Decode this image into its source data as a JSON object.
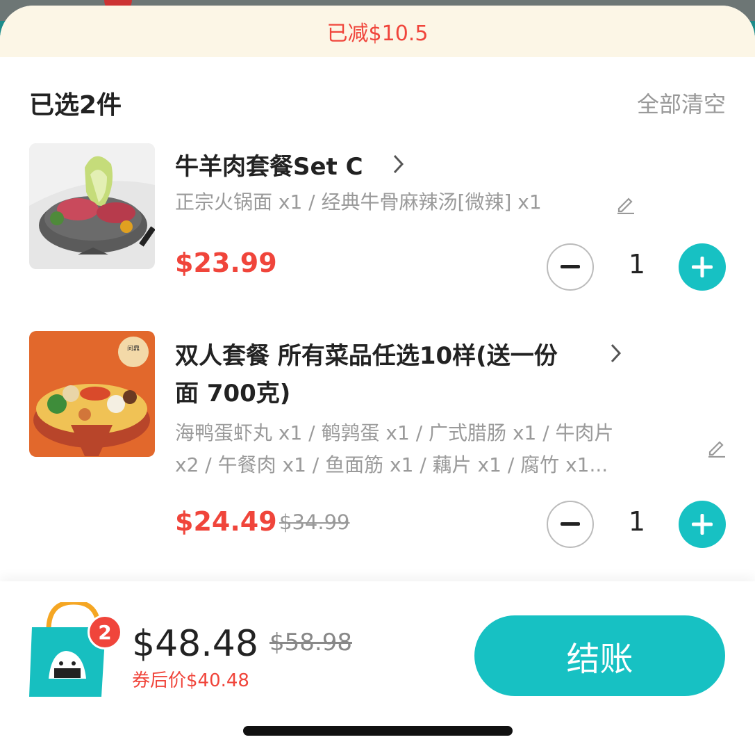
{
  "banner": {
    "discount_text": "已减$10.5"
  },
  "cart": {
    "selected_count": "已选2件",
    "clear_all": "全部清空"
  },
  "items": [
    {
      "name": "牛羊肉套餐Set C",
      "options_line1": "正宗火锅面 x1 / 经典牛骨麻辣汤[微辣] x1",
      "price": "$23.99",
      "quantity": "1"
    },
    {
      "name_line1": "双人套餐 所有菜品任选10样(送一份",
      "name_line2": "面 700克)",
      "options_line1": "海鸭蛋虾丸 x1 / 鹌鹑蛋 x1 / 广式腊肠 x1 / 牛肉片",
      "options_line2": "x2 / 午餐肉 x1 / 鱼面筋 x1 / 藕片 x1 / 腐竹 x1...",
      "price": "$24.49",
      "original_price": "$34.99",
      "quantity": "1",
      "image_label": "问鼎"
    }
  ],
  "footer": {
    "bag_count": "2",
    "total": "$48.48",
    "original_total": "$58.98",
    "coupon_price": "券后价$40.48",
    "checkout_label": "结账"
  },
  "colors": {
    "accent": "#17c1c3",
    "price_red": "#f0453b",
    "banner_bg": "#fcf6e6"
  },
  "icons": [
    "chevron-right-icon",
    "pencil-icon",
    "minus-icon",
    "plus-icon",
    "shopping-bag-icon"
  ]
}
